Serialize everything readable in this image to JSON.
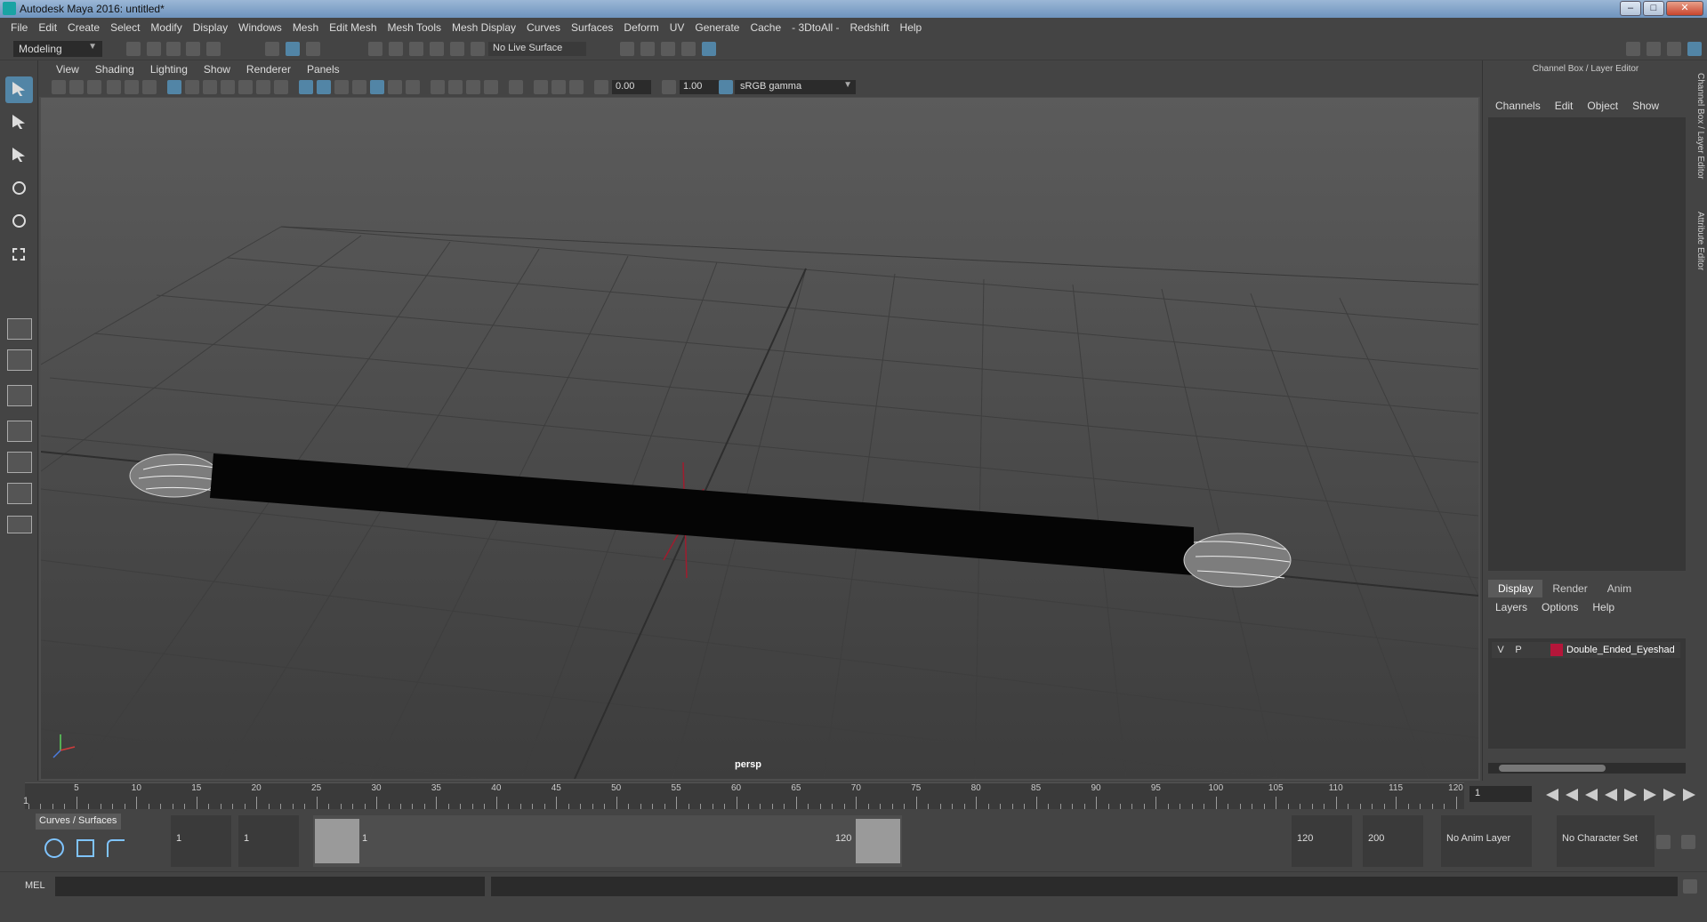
{
  "window": {
    "title": "Autodesk Maya 2016: untitled*"
  },
  "menubar": [
    "File",
    "Edit",
    "Create",
    "Select",
    "Modify",
    "Display",
    "Windows",
    "Mesh",
    "Edit Mesh",
    "Mesh Tools",
    "Mesh Display",
    "Curves",
    "Surfaces",
    "Deform",
    "UV",
    "Generate",
    "Cache",
    "- 3DtoAll -",
    "Redshift",
    "Help"
  ],
  "statusline": {
    "menuset": "Modeling",
    "live_surface": "No Live Surface"
  },
  "panel": {
    "menu": [
      "View",
      "Shading",
      "Lighting",
      "Show",
      "Renderer",
      "Panels"
    ],
    "exposure": "0.00",
    "gamma": "1.00",
    "colorspace": "sRGB gamma",
    "camera": "persp"
  },
  "channelbox": {
    "title": "Channel Box / Layer Editor",
    "menu": [
      "Channels",
      "Edit",
      "Object",
      "Show"
    ],
    "side_tabs": [
      "Channel Box / Layer Editor",
      "Attribute Editor"
    ]
  },
  "layers": {
    "tabs": [
      "Display",
      "Render",
      "Anim"
    ],
    "active_tab": "Display",
    "menu": [
      "Layers",
      "Options",
      "Help"
    ],
    "rows": [
      {
        "v": "V",
        "p": "P",
        "name": "Double_Ended_Eyeshad",
        "color": "#b5163a"
      }
    ]
  },
  "timeslider": {
    "ticks": [
      "5",
      "10",
      "15",
      "20",
      "25",
      "30",
      "35",
      "40",
      "45",
      "50",
      "55",
      "60",
      "65",
      "70",
      "75",
      "80",
      "85",
      "90",
      "95",
      "100",
      "105",
      "110",
      "115",
      "120"
    ],
    "current": "1",
    "frame_field": "1"
  },
  "rangeslider": {
    "shelf_tab": "Curves / Surfaces",
    "start": "1",
    "anim_start": "1",
    "range_start": "1",
    "range_end": "120",
    "end": "120",
    "anim_end": "200",
    "anim_layer": "No Anim Layer",
    "character_set": "No Character Set"
  },
  "cmdline": {
    "label": "MEL"
  }
}
